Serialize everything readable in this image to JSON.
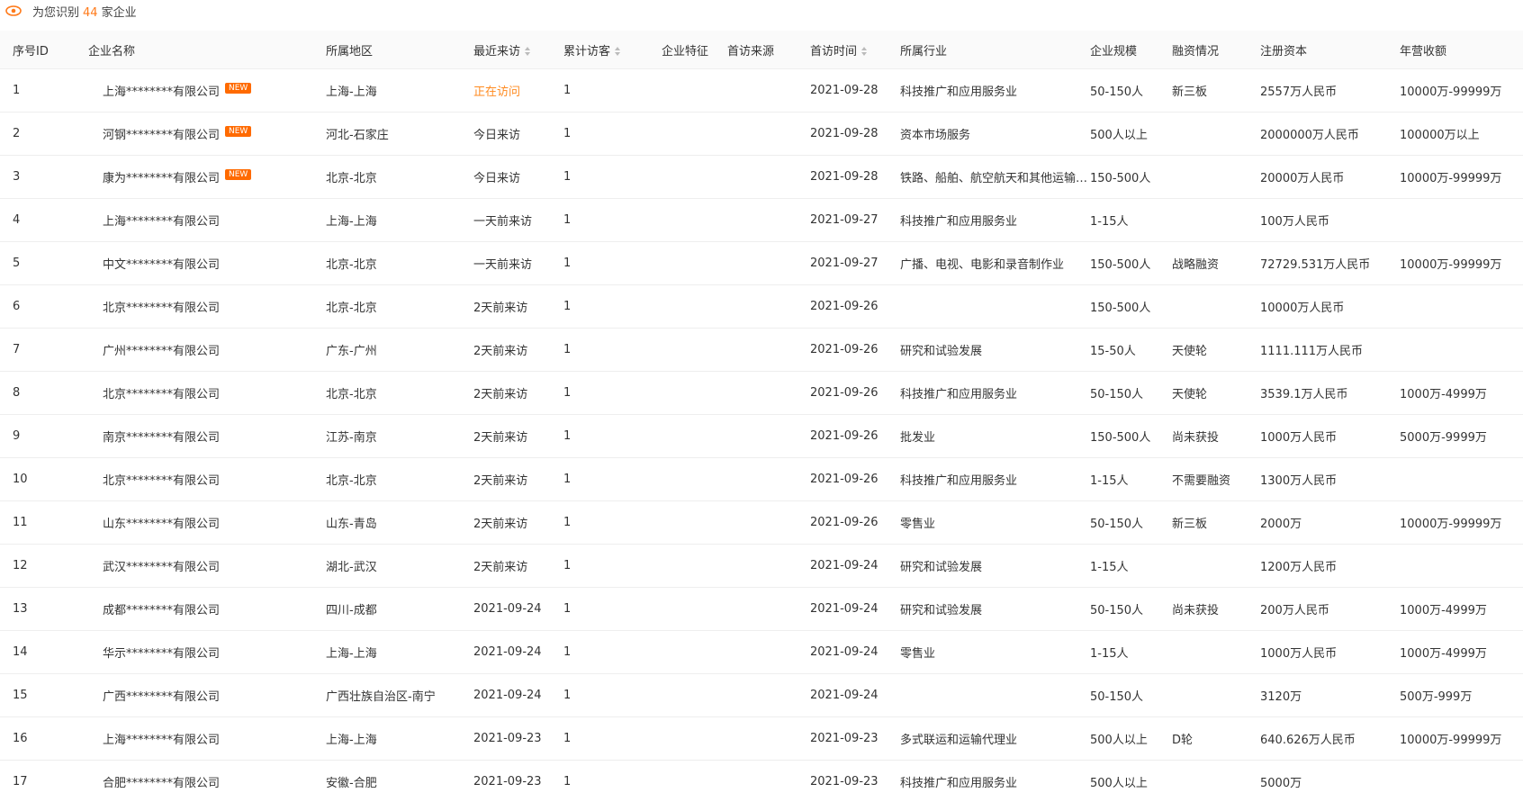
{
  "summary": {
    "prefix": "为您识别",
    "count": "44",
    "suffix": "家企业"
  },
  "columns": {
    "id": "序号ID",
    "name": "企业名称",
    "region": "所属地区",
    "recent": "最近来访",
    "visits": "累计访客",
    "feature": "企业特征",
    "source": "首访来源",
    "first": "首访时间",
    "industry": "所属行业",
    "scale": "企业规模",
    "financing": "融资情况",
    "capital": "注册资本",
    "revenue": "年营收额"
  },
  "badge_new": "NEW",
  "accent_color": "#ff8a1f",
  "rows": [
    {
      "id": "1",
      "name": "上海********有限公司",
      "is_new": true,
      "region": "上海-上海",
      "recent": "正在访问",
      "visiting": true,
      "visits": "1",
      "feature": "",
      "source": "",
      "first": "2021-09-28",
      "industry": "科技推广和应用服务业",
      "scale": "50-150人",
      "financing": "新三板",
      "capital": "2557万人民币",
      "revenue": "10000万-99999万"
    },
    {
      "id": "2",
      "name": "河钢********有限公司",
      "is_new": true,
      "region": "河北-石家庄",
      "recent": "今日来访",
      "visiting": false,
      "visits": "1",
      "feature": "",
      "source": "",
      "first": "2021-09-28",
      "industry": "资本市场服务",
      "scale": "500人以上",
      "financing": "",
      "capital": "2000000万人民币",
      "revenue": "100000万以上"
    },
    {
      "id": "3",
      "name": "康为********有限公司",
      "is_new": true,
      "region": "北京-北京",
      "recent": "今日来访",
      "visiting": false,
      "visits": "1",
      "feature": "",
      "source": "",
      "first": "2021-09-28",
      "industry": "铁路、船舶、航空航天和其他运输设备制造业",
      "scale": "150-500人",
      "financing": "",
      "capital": "20000万人民币",
      "revenue": "10000万-99999万"
    },
    {
      "id": "4",
      "name": "上海********有限公司",
      "is_new": false,
      "region": "上海-上海",
      "recent": "一天前来访",
      "visiting": false,
      "visits": "1",
      "feature": "",
      "source": "",
      "first": "2021-09-27",
      "industry": "科技推广和应用服务业",
      "scale": "1-15人",
      "financing": "",
      "capital": "100万人民币",
      "revenue": ""
    },
    {
      "id": "5",
      "name": "中文********有限公司",
      "is_new": false,
      "region": "北京-北京",
      "recent": "一天前来访",
      "visiting": false,
      "visits": "1",
      "feature": "",
      "source": "",
      "first": "2021-09-27",
      "industry": "广播、电视、电影和录音制作业",
      "scale": "150-500人",
      "financing": "战略融资",
      "capital": "72729.531万人民币",
      "revenue": "10000万-99999万"
    },
    {
      "id": "6",
      "name": "北京********有限公司",
      "is_new": false,
      "region": "北京-北京",
      "recent": "2天前来访",
      "visiting": false,
      "visits": "1",
      "feature": "",
      "source": "",
      "first": "2021-09-26",
      "industry": "",
      "scale": "150-500人",
      "financing": "",
      "capital": "10000万人民币",
      "revenue": ""
    },
    {
      "id": "7",
      "name": "广州********有限公司",
      "is_new": false,
      "region": "广东-广州",
      "recent": "2天前来访",
      "visiting": false,
      "visits": "1",
      "feature": "",
      "source": "",
      "first": "2021-09-26",
      "industry": "研究和试验发展",
      "scale": "15-50人",
      "financing": "天使轮",
      "capital": "1111.111万人民币",
      "revenue": ""
    },
    {
      "id": "8",
      "name": "北京********有限公司",
      "is_new": false,
      "region": "北京-北京",
      "recent": "2天前来访",
      "visiting": false,
      "visits": "1",
      "feature": "",
      "source": "",
      "first": "2021-09-26",
      "industry": "科技推广和应用服务业",
      "scale": "50-150人",
      "financing": "天使轮",
      "capital": "3539.1万人民币",
      "revenue": "1000万-4999万"
    },
    {
      "id": "9",
      "name": "南京********有限公司",
      "is_new": false,
      "region": "江苏-南京",
      "recent": "2天前来访",
      "visiting": false,
      "visits": "1",
      "feature": "",
      "source": "",
      "first": "2021-09-26",
      "industry": "批发业",
      "scale": "150-500人",
      "financing": "尚未获投",
      "capital": "1000万人民币",
      "revenue": "5000万-9999万"
    },
    {
      "id": "10",
      "name": "北京********有限公司",
      "is_new": false,
      "region": "北京-北京",
      "recent": "2天前来访",
      "visiting": false,
      "visits": "1",
      "feature": "",
      "source": "",
      "first": "2021-09-26",
      "industry": "科技推广和应用服务业",
      "scale": "1-15人",
      "financing": "不需要融资",
      "capital": "1300万人民币",
      "revenue": ""
    },
    {
      "id": "11",
      "name": "山东********有限公司",
      "is_new": false,
      "region": "山东-青岛",
      "recent": "2天前来访",
      "visiting": false,
      "visits": "1",
      "feature": "",
      "source": "",
      "first": "2021-09-26",
      "industry": "零售业",
      "scale": "50-150人",
      "financing": "新三板",
      "capital": "2000万",
      "revenue": "10000万-99999万"
    },
    {
      "id": "12",
      "name": "武汉********有限公司",
      "is_new": false,
      "region": "湖北-武汉",
      "recent": "2天前来访",
      "visiting": false,
      "visits": "1",
      "feature": "",
      "source": "",
      "first": "2021-09-24",
      "industry": "研究和试验发展",
      "scale": "1-15人",
      "financing": "",
      "capital": "1200万人民币",
      "revenue": ""
    },
    {
      "id": "13",
      "name": "成都********有限公司",
      "is_new": false,
      "region": "四川-成都",
      "recent": "2021-09-24",
      "visiting": false,
      "visits": "1",
      "feature": "",
      "source": "",
      "first": "2021-09-24",
      "industry": "研究和试验发展",
      "scale": "50-150人",
      "financing": "尚未获投",
      "capital": "200万人民币",
      "revenue": "1000万-4999万"
    },
    {
      "id": "14",
      "name": "华示********有限公司",
      "is_new": false,
      "region": "上海-上海",
      "recent": "2021-09-24",
      "visiting": false,
      "visits": "1",
      "feature": "",
      "source": "",
      "first": "2021-09-24",
      "industry": "零售业",
      "scale": "1-15人",
      "financing": "",
      "capital": "1000万人民币",
      "revenue": "1000万-4999万"
    },
    {
      "id": "15",
      "name": "广西********有限公司",
      "is_new": false,
      "region": "广西壮族自治区-南宁",
      "recent": "2021-09-24",
      "visiting": false,
      "visits": "1",
      "feature": "",
      "source": "",
      "first": "2021-09-24",
      "industry": "",
      "scale": "50-150人",
      "financing": "",
      "capital": "3120万",
      "revenue": "500万-999万"
    },
    {
      "id": "16",
      "name": "上海********有限公司",
      "is_new": false,
      "region": "上海-上海",
      "recent": "2021-09-23",
      "visiting": false,
      "visits": "1",
      "feature": "",
      "source": "",
      "first": "2021-09-23",
      "industry": "多式联运和运输代理业",
      "scale": "500人以上",
      "financing": "D轮",
      "capital": "640.626万人民币",
      "revenue": "10000万-99999万"
    },
    {
      "id": "17",
      "name": "合肥********有限公司",
      "is_new": false,
      "region": "安徽-合肥",
      "recent": "2021-09-23",
      "visiting": false,
      "visits": "1",
      "feature": "",
      "source": "",
      "first": "2021-09-23",
      "industry": "科技推广和应用服务业",
      "scale": "500人以上",
      "financing": "",
      "capital": "5000万",
      "revenue": ""
    }
  ]
}
